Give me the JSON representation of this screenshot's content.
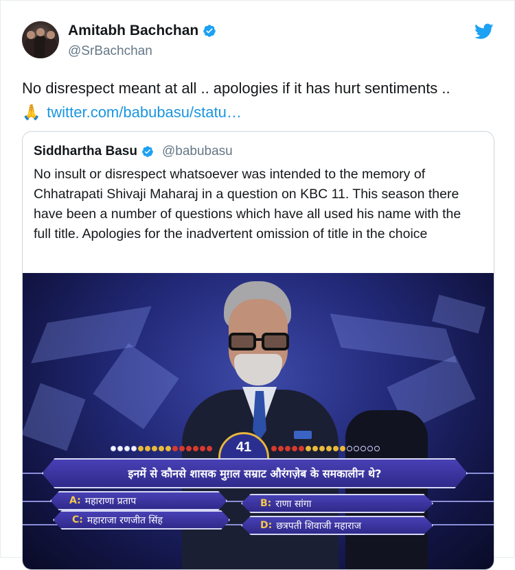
{
  "author": {
    "name": "Amitabh Bachchan",
    "handle": "@SrBachchan",
    "verified_icon": "verified-badge-icon",
    "platform_icon": "twitter-bird-icon",
    "accent_color": "#1da1f2"
  },
  "tweet": {
    "text": "No disrespect meant at all .. apologies if it has hurt sentiments  ..",
    "emoji": "🙏",
    "link": "twitter.com/babubasu/statu…"
  },
  "quoted_tweet": {
    "name": "Siddhartha Basu",
    "handle": "@babubasu",
    "text": "No insult or disrespect whatsoever was intended to the memory of Chhatrapati Shivaji Maharaj in a question on KBC 11. This season there have been a number of questions which have all used his name with the full title. Apologies for the inadvertent omission of title in the choice"
  },
  "kbc_screen": {
    "timer": "41",
    "question": "इनमें से कौनसे शासक मुग़ल सम्राट औरंगज़ेब के समकालीन थे?",
    "options": [
      {
        "letter": "A:",
        "text": "महाराणा प्रताप"
      },
      {
        "letter": "B:",
        "text": "राणा सांगा"
      },
      {
        "letter": "C:",
        "text": "महाराजा रणजीत सिंह"
      },
      {
        "letter": "D:",
        "text": "छत्रपती शिवाजी महाराज"
      }
    ]
  }
}
